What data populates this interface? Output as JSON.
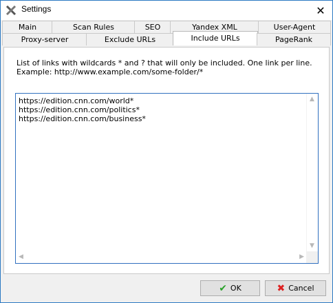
{
  "window": {
    "title": "Settings"
  },
  "tabs": {
    "row1": [
      "Main",
      "Scan Rules",
      "SEO",
      "Yandex XML",
      "User-Agent"
    ],
    "row2": [
      "Proxy-server",
      "Exclude URLs",
      "Include URLs",
      "PageRank"
    ],
    "active": "Include URLs"
  },
  "content": {
    "description": "List of links with wildcards * and ? that will only be included. One link per line. Example: http://www.example.com/some-folder/*",
    "links": [
      "https://edition.cnn.com/world*",
      "https://edition.cnn.com/politics*",
      "https://edition.cnn.com/business*"
    ]
  },
  "buttons": {
    "ok": "OK",
    "cancel": "Cancel"
  },
  "icons": {
    "app": "settings-tools-icon",
    "close": "close-icon",
    "ok": "checkmark-icon",
    "cancel": "x-icon"
  }
}
